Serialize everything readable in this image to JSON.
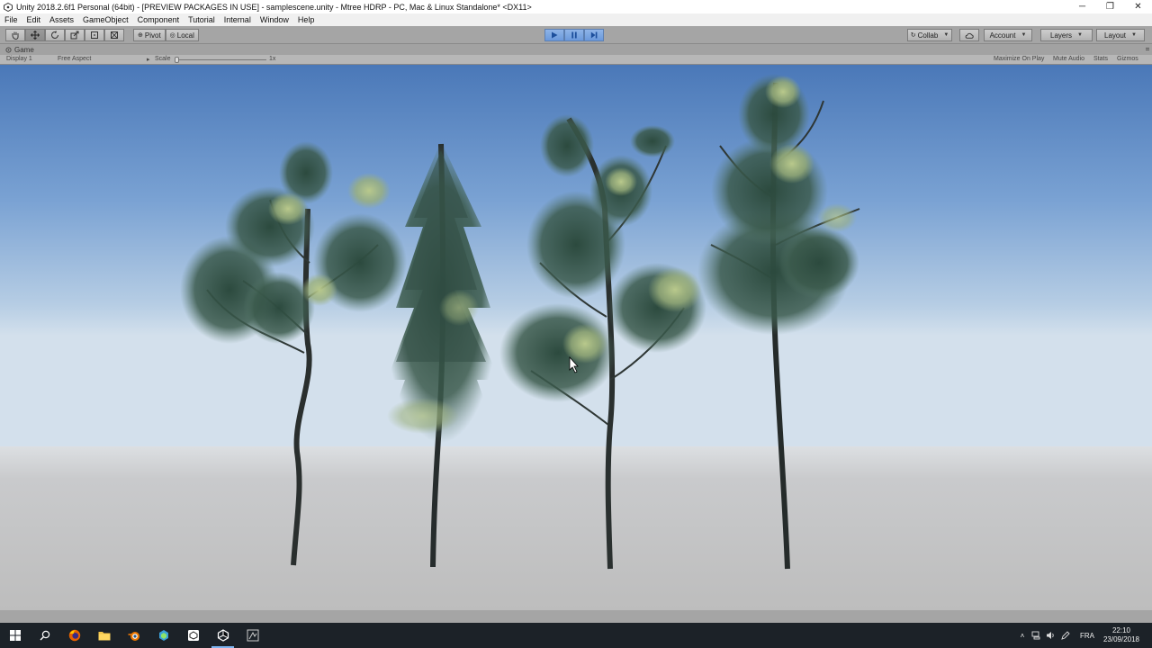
{
  "window": {
    "title": "Unity 2018.2.6f1 Personal (64bit) - [PREVIEW PACKAGES IN USE] - samplescene.unity - Mtree HDRP - PC, Mac & Linux Standalone* <DX11>",
    "minimize": "─",
    "maximize": "❐",
    "close": "✕"
  },
  "menu": [
    "File",
    "Edit",
    "Assets",
    "GameObject",
    "Component",
    "Tutorial",
    "Internal",
    "Window",
    "Help"
  ],
  "toolbar": {
    "pivot_label": "Pivot",
    "local_label": "Local",
    "collab_label": "Collab",
    "account_label": "Account",
    "layers_label": "Layers",
    "layout_label": "Layout"
  },
  "game_panel": {
    "tab_label": "Game",
    "display_label": "Display 1",
    "aspect_label": "Free Aspect",
    "scale_label": "Scale",
    "scale_value": "1x",
    "maximize_on_play": "Maximize On Play",
    "mute_audio": "Mute Audio",
    "stats": "Stats",
    "gizmos": "Gizmos"
  },
  "taskbar": {
    "language": "FRA",
    "time": "22:10",
    "date": "23/09/2018"
  },
  "colors": {
    "sky_top": "#4a78b8",
    "sky_horizon": "#cddcea",
    "ground": "#c3c3c3",
    "play_blue": "#6a99dc",
    "taskbar": "#1c2228"
  }
}
